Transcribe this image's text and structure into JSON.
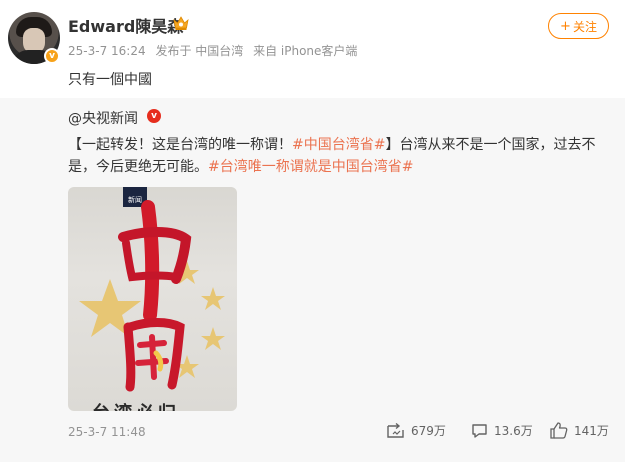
{
  "post": {
    "author": "Edward陳昊森",
    "time": "25-3-7 16:24",
    "location": "发布于 中国台湾",
    "source": "来自 iPhone客户端",
    "follow_label": "关注",
    "follow_plus": "+",
    "text": "只有一個中國",
    "avatar_badge": "v"
  },
  "repost": {
    "author": "@央视新闻",
    "verify_badge": "v",
    "text_part1": "【一起转发！这是台湾的唯一称谓！",
    "hashtag1": "#中国台湾省#",
    "text_part2": "】台湾从来不是一个国家，过去不是，今后更绝无可能。",
    "hashtag2": "#台湾唯一称谓就是中国台湾省#",
    "media_tag": "新闻",
    "media_caption": "台湾必归",
    "date": "25-3-7 11:48",
    "stats": {
      "reposts": "679万",
      "comments": "13.6万",
      "likes": "141万"
    }
  },
  "colors": {
    "accent": "#ff8200",
    "hashtag": "#eb7350",
    "verified_orange": "#f7a21a",
    "verified_red": "#e62e1e"
  }
}
